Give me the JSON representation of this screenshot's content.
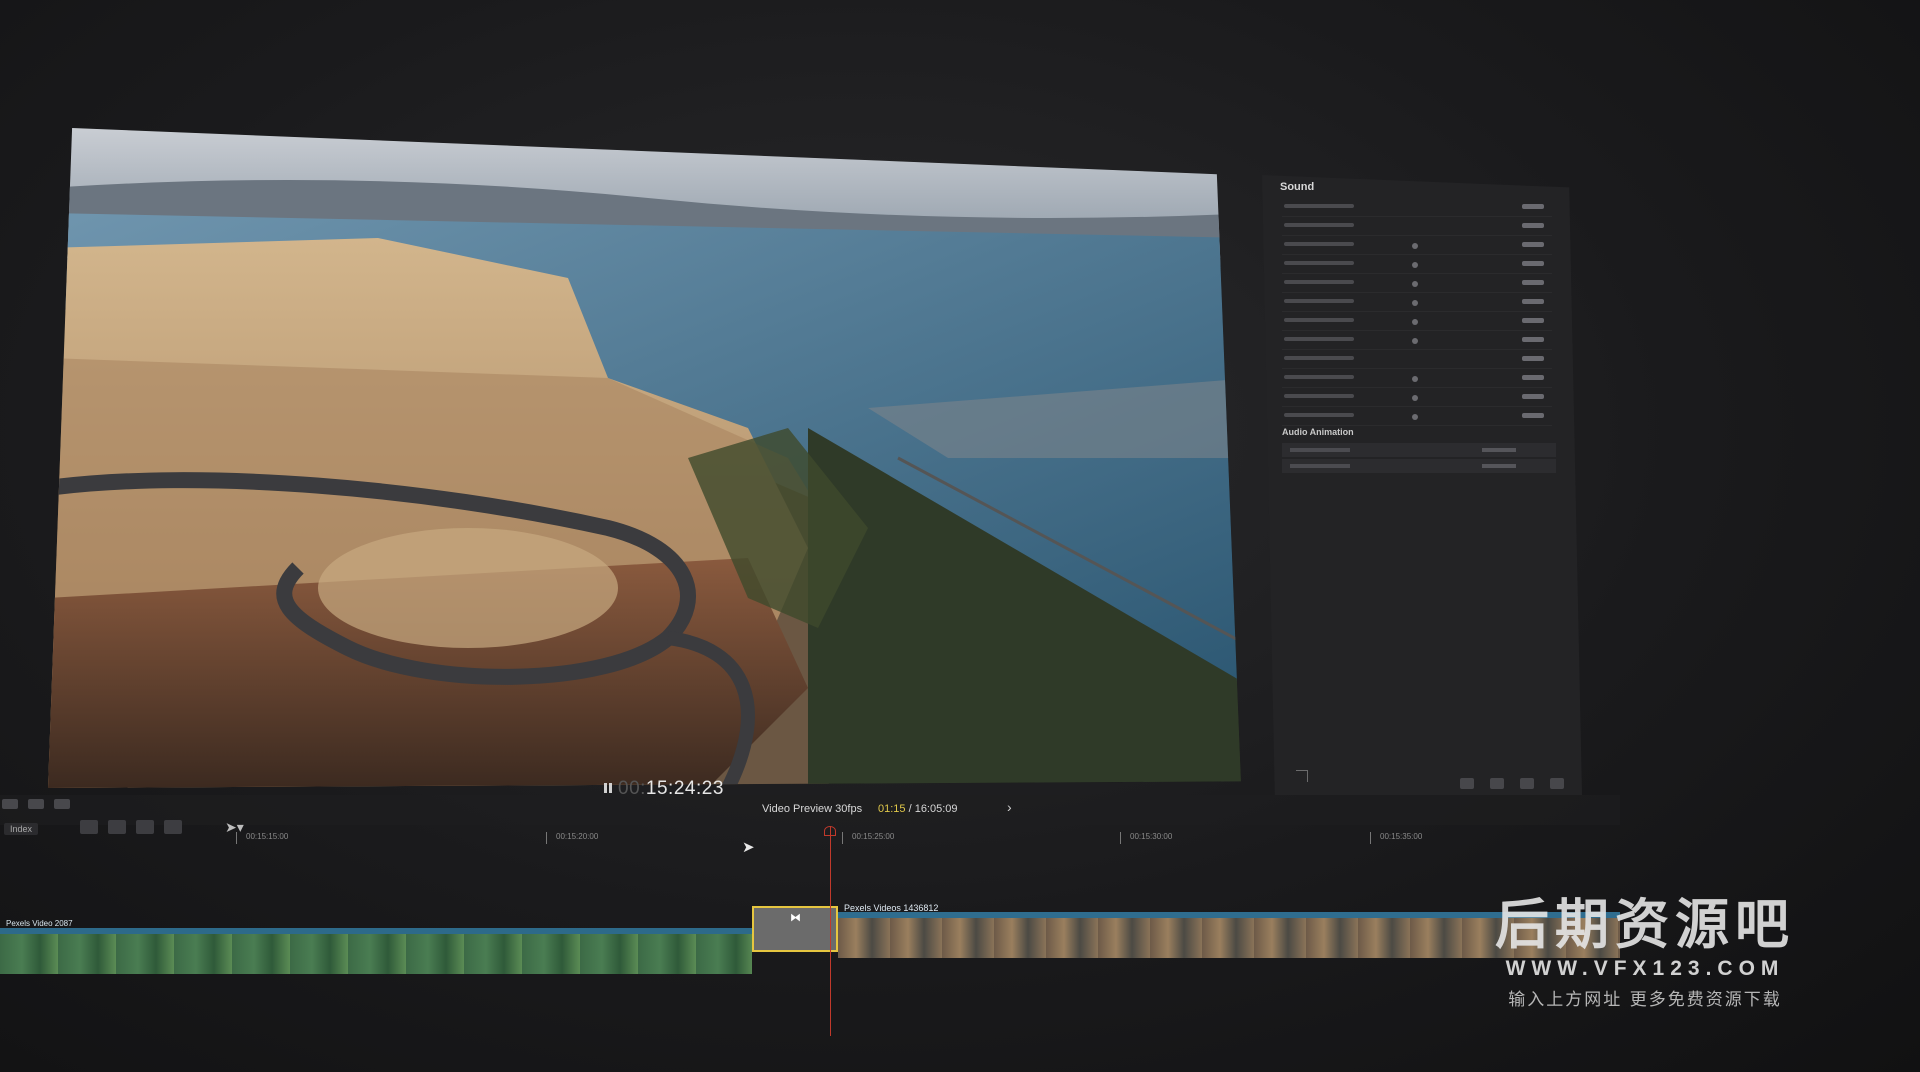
{
  "viewer": {
    "timecode_prefix": "00:",
    "timecode": "15:24:23"
  },
  "inspector": {
    "header": "Sound",
    "audio_section_title": "Audio Animation"
  },
  "toolbar": {
    "index_label": "Index",
    "preview_label": "Video Preview 30fps",
    "preview_current": "01:15",
    "preview_total": " / 16:05:09"
  },
  "ruler": {
    "labels": [
      "00:15:15:00",
      "00:15:20:00",
      "00:15:25:00",
      "00:15:30:00",
      "00:15:35:00"
    ]
  },
  "timeline": {
    "clip_b_label": "Pexels Videos 1436812",
    "clip_a_label": "Pexels Video 2087"
  },
  "watermark": {
    "title": "后期资源吧",
    "url": "WWW.VFX123.COM",
    "sub": "输入上方网址 更多免费资源下载"
  },
  "icons": [
    "pause-icon",
    "fullscreen-icon",
    "select-arrow-icon",
    "next-arrow-icon",
    "mouse-cursor-icon",
    "transition-bowtie-icon"
  ]
}
